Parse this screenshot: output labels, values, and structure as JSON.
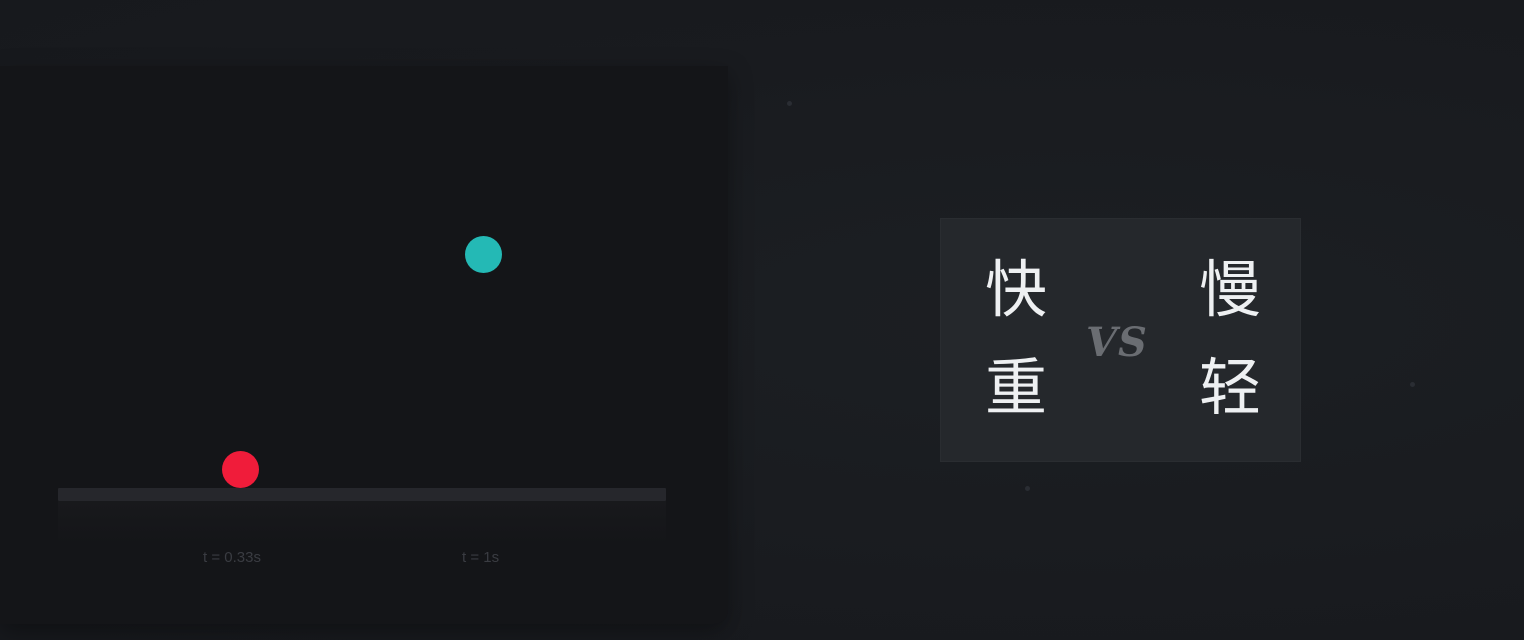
{
  "animation": {
    "balls": [
      {
        "name": "red-ball",
        "color": "#f01c3a"
      },
      {
        "name": "teal-ball",
        "color": "#24b9b5"
      }
    ],
    "labels": {
      "red_time": "t = 0.33s",
      "teal_time": "t = 1s"
    }
  },
  "comparison": {
    "left_top": "快",
    "left_bottom": "重",
    "vs": "VS",
    "right_top": "慢",
    "right_bottom": "轻"
  }
}
